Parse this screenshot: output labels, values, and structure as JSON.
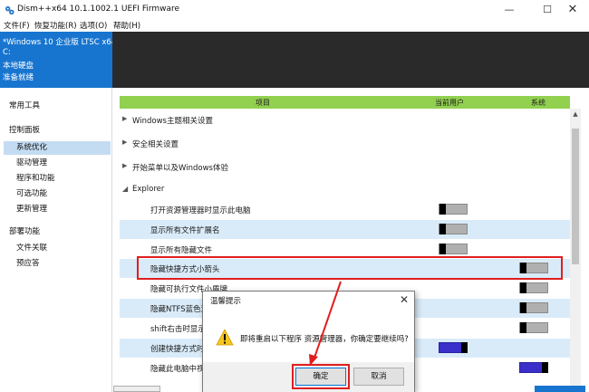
{
  "window": {
    "title": "Dism++x64 10.1.1002.1 UEFI Firmware",
    "min": "—",
    "max": "☐",
    "close": "✕"
  },
  "menu": [
    "文件(F)",
    "恢复功能(R)",
    "选项(O)",
    "帮助(H)"
  ],
  "sysinfo": {
    "os": "*Windows 10 企业版 LTSC x64",
    "drive": "C:",
    "disk": "本地硬盘",
    "status": "准备就绪"
  },
  "sidebar": {
    "groups": [
      {
        "label": "常用工具",
        "items": []
      },
      {
        "label": "控制面板",
        "items": [
          "系统优化",
          "驱动管理",
          "程序和功能",
          "可选功能",
          "更新管理"
        ]
      },
      {
        "label": "部署功能",
        "items": [
          "文件关联",
          "预应答"
        ]
      }
    ],
    "active_item": "系统优化"
  },
  "table": {
    "headers": {
      "item": "项目",
      "current_user": "当前用户",
      "system": "系统"
    },
    "categories": [
      "Windows主题相关设置",
      "安全相关设置",
      "开始菜单以及Windows体验",
      "Explorer"
    ],
    "rows": [
      {
        "label": "打开资源管理器时显示此电脑",
        "user_on": false
      },
      {
        "label": "显示所有文件扩展名",
        "user_on": false
      },
      {
        "label": "显示所有隐藏文件",
        "user_on": false
      },
      {
        "label": "隐藏快捷方式小箭头",
        "system_on": false
      },
      {
        "label": "隐藏可执行文件小盾牌",
        "system_on": false
      },
      {
        "label": "隐藏NTFS蓝色双箭头",
        "system_on": false
      },
      {
        "label": "shift右击时显示",
        "system_on": false
      },
      {
        "label": "创建快捷方式时",
        "user_on": true
      },
      {
        "label": "隐藏此电脑中视",
        "system_on": true
      }
    ]
  },
  "dialog": {
    "title": "温馨提示",
    "close": "✕",
    "message": "即将重启以下程序 资源管理器，你确定要继续吗?",
    "ok_label": "确定",
    "cancel_label": "取消"
  },
  "colors": {
    "header_blue": "#1875cf",
    "header_dark": "#2a2a2a",
    "column_header_green": "#92d050",
    "row_alt": "#d9ebf9",
    "highlight_red": "#e01e1e",
    "toggle_on": "#3a2fc9"
  }
}
